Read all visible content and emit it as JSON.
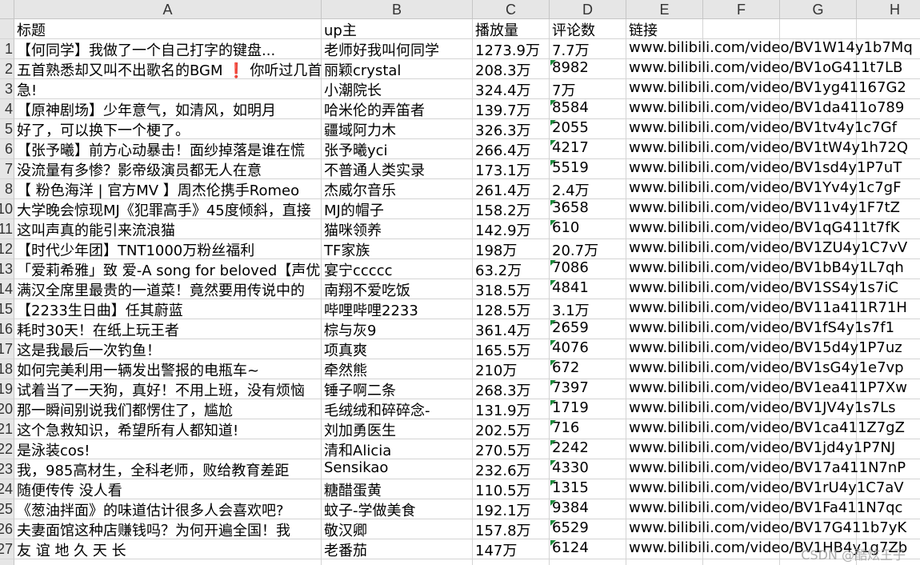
{
  "columns": [
    "A",
    "B",
    "C",
    "D",
    "E",
    "F",
    "G",
    "H"
  ],
  "headers": [
    "标题",
    "up主",
    "播放量",
    "评论数",
    "链接"
  ],
  "rows": [
    {
      "n": "1",
      "title": "【何同学】我做了一个自己打字的键盘...",
      "up": "老师好我叫何同学",
      "play": "1273.9万",
      "comments": "7.7万",
      "link": "www.bilibili.com/video/BV1W14y1b7Mq",
      "flag": false
    },
    {
      "n": "2",
      "title": "五首熟悉却又叫不出歌名的BGM ❗ 你听过几首",
      "up": "丽颖crystal",
      "play": "208.3万",
      "comments": "8982",
      "link": "www.bilibili.com/video/BV1oG411t7LB",
      "flag": true
    },
    {
      "n": "3",
      "title": "急!",
      "up": "小潮院长",
      "play": "324.4万",
      "comments": "7万",
      "link": "www.bilibili.com/video/BV1yg41167G2",
      "flag": false
    },
    {
      "n": "4",
      "title": "【原神剧场】少年意气，如清风，如明月",
      "up": "哈米伦的弄笛者",
      "play": "139.7万",
      "comments": "8584",
      "link": "www.bilibili.com/video/BV1da411o789",
      "flag": true
    },
    {
      "n": "5",
      "title": "好了，可以换下一个梗了。",
      "up": "疆域阿力木",
      "play": "326.3万",
      "comments": "2055",
      "link": "www.bilibili.com/video/BV1tv4y1c7Gf",
      "flag": true
    },
    {
      "n": "6",
      "title": "【张予曦】前方心动暴击！面纱掉落是谁在慌",
      "up": "张予曦yci",
      "play": "266.4万",
      "comments": "4217",
      "link": "www.bilibili.com/video/BV1tW4y1h72Q",
      "flag": true
    },
    {
      "n": "7",
      "title": "没流量有多惨？影帝级演员都无人在意",
      "up": "不普通人类实录",
      "play": "173.1万",
      "comments": "5519",
      "link": "www.bilibili.com/video/BV1sd4y1P7uT",
      "flag": true
    },
    {
      "n": "8",
      "title": "【 粉色海洋 | 官方MV 】周杰伦携手Romeo",
      "up": "杰威尔音乐",
      "play": "261.4万",
      "comments": "2.4万",
      "link": "www.bilibili.com/video/BV1Yv4y1c7gF",
      "flag": false
    },
    {
      "n": "10",
      "title": "大学晚会惊现MJ《犯罪高手》45度倾斜，直接",
      "up": "MJ的帽子",
      "play": "158.2万",
      "comments": "3658",
      "link": "www.bilibili.com/video/BV11v4y1F7tZ",
      "flag": true
    },
    {
      "n": "11",
      "title": "这叫声真的能引来流浪猫",
      "up": "猫咪领养",
      "play": "142.9万",
      "comments": "610",
      "link": "www.bilibili.com/video/BV1qG411t7fK",
      "flag": true
    },
    {
      "n": "12",
      "title": "【时代少年团】TNT1000万粉丝福利",
      "up": "TF家族",
      "play": "198万",
      "comments": "20.7万",
      "link": "www.bilibili.com/video/BV1ZU4y1C7vV",
      "flag": false
    },
    {
      "n": "13",
      "title": "「爱莉希雅」致 爱-A song for beloved【声优",
      "up": "宴宁ccccc",
      "play": "63.2万",
      "comments": "7086",
      "link": "www.bilibili.com/video/BV1bB4y1L7qh",
      "flag": true
    },
    {
      "n": "14",
      "title": "满汉全席里最贵的一道菜！竟然要用传说中的",
      "up": "南翔不爱吃饭",
      "play": "318.5万",
      "comments": "4841",
      "link": "www.bilibili.com/video/BV1SS4y1s7iC",
      "flag": true
    },
    {
      "n": "15",
      "title": "【2233生日曲】任其蔚蓝",
      "up": "哔哩哔哩2233",
      "play": "128.5万",
      "comments": "3.1万",
      "link": "www.bilibili.com/video/BV11a411R71H",
      "flag": false
    },
    {
      "n": "16",
      "title": "耗时30天！在纸上玩王者",
      "up": "棕与灰9",
      "play": "361.4万",
      "comments": "2659",
      "link": "www.bilibili.com/video/BV1fS4y1s7f1",
      "flag": true
    },
    {
      "n": "17",
      "title": "这是我最后一次钓鱼！",
      "up": "项真爽",
      "play": "165.5万",
      "comments": "4076",
      "link": "www.bilibili.com/video/BV15d4y1P7uz",
      "flag": true
    },
    {
      "n": "18",
      "title": "如何完美利用一辆发出警报的电瓶车~",
      "up": "牵然熊",
      "play": "210万",
      "comments": "672",
      "link": "www.bilibili.com/video/BV1sG4y1e7vp",
      "flag": true
    },
    {
      "n": "19",
      "title": "试着当了一天狗，真好！不用上班，没有烦恼",
      "up": "锤子啊二条",
      "play": "268.3万",
      "comments": "7397",
      "link": "www.bilibili.com/video/BV1ea411P7Xw",
      "flag": true
    },
    {
      "n": "20",
      "title": "那一瞬间别说我们都愣住了，尴尬",
      "up": "毛绒绒和碎碎念-",
      "play": "131.9万",
      "comments": "1719",
      "link": "www.bilibili.com/video/BV1JV4y1s7Ls",
      "flag": true
    },
    {
      "n": "21",
      "title": "这个急救知识，希望所有人都知道!",
      "up": "刘加勇医生",
      "play": "202.5万",
      "comments": "716",
      "link": "www.bilibili.com/video/BV1ca411Z7gZ",
      "flag": true
    },
    {
      "n": "22",
      "title": "是泳装cos!",
      "up": "清和Alicia",
      "play": "270.5万",
      "comments": "2242",
      "link": "www.bilibili.com/video/BV1jd4y1P7NJ",
      "flag": true
    },
    {
      "n": "23",
      "title": "我，985高材生，全科老师，败给教育差距",
      "up": "Sensikao",
      "play": "232.6万",
      "comments": "4330",
      "link": "www.bilibili.com/video/BV17a411N7nP",
      "flag": true
    },
    {
      "n": "24",
      "title": "随便传传 没人看",
      "up": "糖醋蛋黄",
      "play": "110.5万",
      "comments": "1315",
      "link": "www.bilibili.com/video/BV1rU4y1C7aV",
      "flag": true
    },
    {
      "n": "25",
      "title": "《葱油拌面》的味道估计很多人会喜欢吧?",
      "up": "蚊子-学做美食",
      "play": "192.1万",
      "comments": "9384",
      "link": "www.bilibili.com/video/BV1Fa411N7qc",
      "flag": true
    },
    {
      "n": "26",
      "title": "夫妻面馆这种店赚钱吗？为何开遍全国！我",
      "up": "敬汉卿",
      "play": "157.8万",
      "comments": "6529",
      "link": "www.bilibili.com/video/BV17G411b7yK",
      "flag": true
    },
    {
      "n": "27",
      "title": "友 谊 地 久 天 长",
      "up": "老番茄",
      "play": "147万",
      "comments": "6124",
      "link": "www.bilibili.com/video/BV1HB4y1g7Zb",
      "flag": true
    }
  ],
  "watermark": "CSDN @酷炫王子",
  "flag_color": "#1a8a3a",
  "gridline_color": "#d4d4d4"
}
